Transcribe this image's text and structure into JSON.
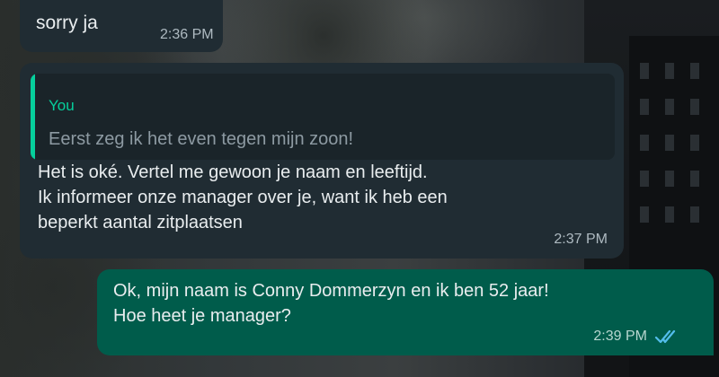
{
  "messages": [
    {
      "direction": "incoming",
      "text": "sorry ja",
      "time": "2:36 PM"
    },
    {
      "direction": "incoming",
      "quoted": {
        "author": "You",
        "text": "Eerst zeg ik het even tegen mijn zoon!"
      },
      "lines": [
        "Het is oké. Vertel me gewoon je naam en leeftijd.",
        "Ik informeer onze manager over je, want ik heb een",
        "beperkt aantal zitplaatsen"
      ],
      "time": "2:37 PM"
    },
    {
      "direction": "outgoing",
      "lines": [
        "Ok, mijn naam is Conny Dommerzyn en ik ben 52 jaar!",
        "Hoe heet je manager?"
      ],
      "time": "2:39 PM",
      "status_icon": "double-check-read-icon"
    }
  ],
  "colors": {
    "incoming_bubble": "#202c33",
    "outgoing_bubble": "#005c4b",
    "quote_accent": "#06cf9c",
    "read_ticks": "#53bdeb"
  }
}
